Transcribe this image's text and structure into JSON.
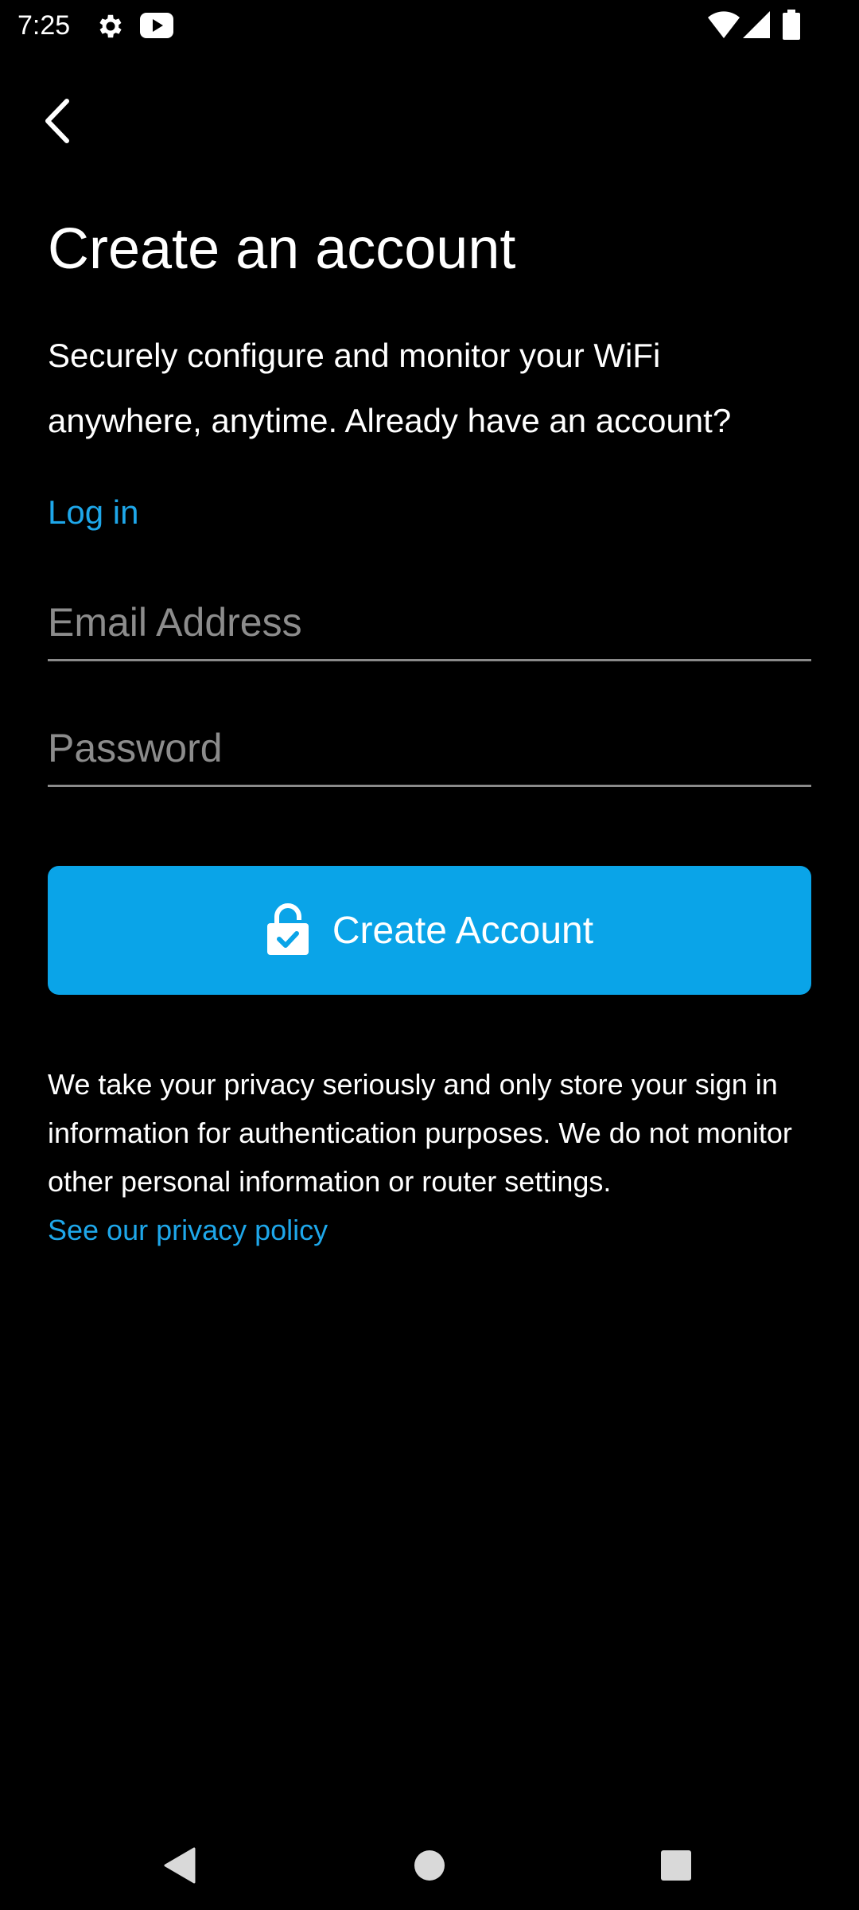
{
  "status_bar": {
    "time": "7:25",
    "icons": [
      "settings-icon",
      "youtube-icon",
      "wifi-icon",
      "signal-icon",
      "battery-icon"
    ]
  },
  "header": {
    "back_icon": "chevron-left-icon"
  },
  "main": {
    "title": "Create an account",
    "subtitle": "Securely configure and monitor your WiFi anywhere, anytime. Already have an account?",
    "login_link": "Log in",
    "email_placeholder": "Email Address",
    "email_value": "",
    "password_placeholder": "Password",
    "password_value": "",
    "create_button_label": "Create Account",
    "create_button_icon": "lock-check-icon",
    "privacy_text": "We take your privacy seriously and only store your sign in information for authentication purposes. We do not monitor other personal information or router settings.",
    "privacy_link": "See our privacy policy"
  },
  "nav_bar": {
    "back": "nav-back-icon",
    "home": "nav-home-icon",
    "recents": "nav-recents-icon"
  },
  "colors": {
    "background": "#000000",
    "accent": "#0aa4e8",
    "link": "#1ea7ea",
    "placeholder": "#8c8c8c"
  }
}
